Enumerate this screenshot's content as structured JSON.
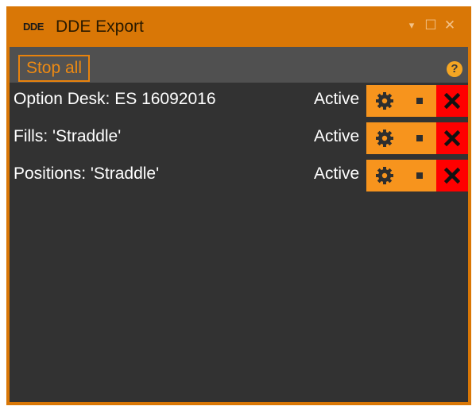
{
  "window": {
    "logo_text": "DDE",
    "title": "DDE Export",
    "controls": {
      "dropdown_icon": "▾",
      "maximize_icon": "☐",
      "close_icon": "✕"
    }
  },
  "toolbar": {
    "stop_all_label": "Stop all",
    "help_icon": "?"
  },
  "rows": [
    {
      "label": "Option Desk: ES 16092016",
      "status": "Active"
    },
    {
      "label": "Fills: 'Straddle'",
      "status": "Active"
    },
    {
      "label": "Positions: 'Straddle'",
      "status": "Active"
    }
  ],
  "colors": {
    "frame": "#d97706",
    "accent": "#f7941d",
    "toolbar_bg": "#505050",
    "content_bg": "#323232",
    "delete_bg": "#ff0000"
  }
}
